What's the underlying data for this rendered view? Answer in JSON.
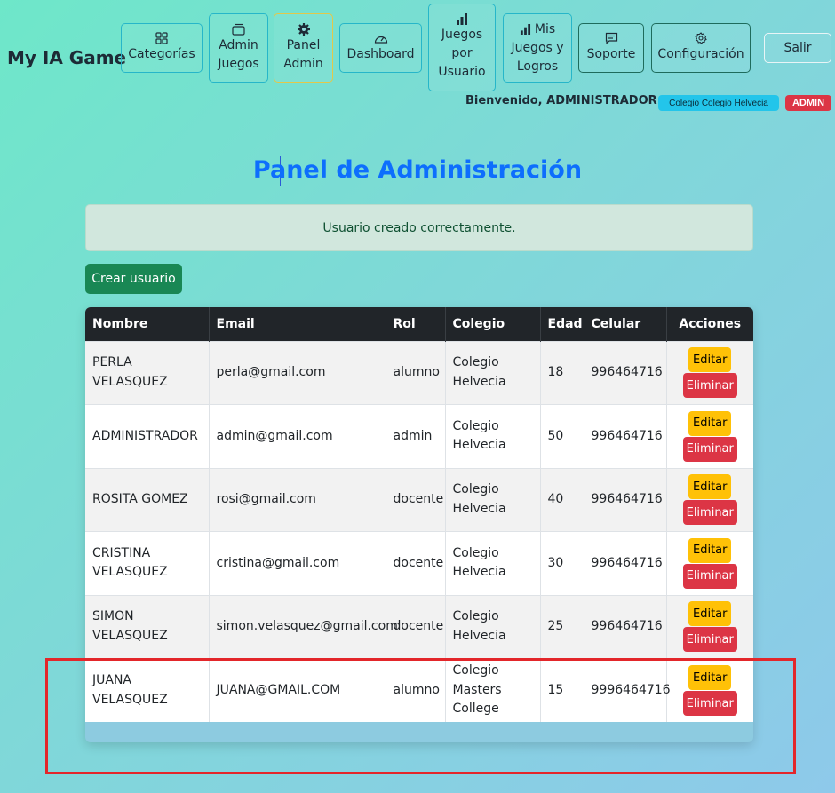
{
  "brand": "My IA Game",
  "nav": {
    "categorias": "Categorías",
    "admin_juegos_1": "Admin",
    "admin_juegos_2": "Juegos",
    "panel_admin_1": "Panel",
    "panel_admin_2": "Admin",
    "dashboard": "Dashboard",
    "juegos_usuario_1": "Juegos",
    "juegos_usuario_2": "por",
    "juegos_usuario_3": "Usuario",
    "mis_juegos_1": "Mis",
    "mis_juegos_2": "Juegos y",
    "mis_juegos_3": "Logros",
    "soporte": "Soporte",
    "configuracion": "Configuración",
    "salir": "Salir"
  },
  "user": {
    "welcome": "Bienvenido, ADMINISTRADOR",
    "school_badge": "Colegio Colegio Helvecia",
    "role_badge": "ADMIN"
  },
  "page": {
    "title": "Panel de Administración",
    "alert": "Usuario creado correctamente.",
    "create_button": "Crear usuario"
  },
  "table": {
    "headers": {
      "nombre": "Nombre",
      "email": "Email",
      "rol": "Rol",
      "colegio": "Colegio",
      "edad": "Edad",
      "celular": "Celular",
      "acciones": "Acciones"
    },
    "edit_label": "Editar",
    "delete_label": "Eliminar",
    "rows": [
      {
        "nombre_1": "PERLA VELASQUEZ",
        "nombre_2": "",
        "email": "perla@gmail.com",
        "rol": "alumno",
        "colegio_1": "Colegio",
        "colegio_2": "Helvecia",
        "colegio_3": "",
        "edad": "18",
        "celular": "996464716"
      },
      {
        "nombre_1": "ADMINISTRADOR",
        "nombre_2": "",
        "email": "admin@gmail.com",
        "rol": "admin",
        "colegio_1": "Colegio",
        "colegio_2": "Helvecia",
        "colegio_3": "",
        "edad": "50",
        "celular": "996464716"
      },
      {
        "nombre_1": "ROSITA GOMEZ",
        "nombre_2": "",
        "email": "rosi@gmail.com",
        "rol": "docente",
        "colegio_1": "Colegio",
        "colegio_2": "Helvecia",
        "colegio_3": "",
        "edad": "40",
        "celular": "996464716"
      },
      {
        "nombre_1": "CRISTINA",
        "nombre_2": "VELASQUEZ",
        "email": "cristina@gmail.com",
        "rol": "docente",
        "colegio_1": "Colegio",
        "colegio_2": "Helvecia",
        "colegio_3": "",
        "edad": "30",
        "celular": "996464716"
      },
      {
        "nombre_1": "SIMON",
        "nombre_2": "VELASQUEZ",
        "email": "simon.velasquez@gmail.com",
        "rol": "docente",
        "colegio_1": "Colegio",
        "colegio_2": "Helvecia",
        "colegio_3": "",
        "edad": "25",
        "celular": "996464716"
      },
      {
        "nombre_1": "JUANA",
        "nombre_2": "VELASQUEZ",
        "email": "JUANA@GMAIL.COM",
        "rol": "alumno",
        "colegio_1": "Colegio",
        "colegio_2": "Masters",
        "colegio_3": "College",
        "edad": "15",
        "celular": "9996464716"
      }
    ]
  },
  "colors": {
    "accent": "#0d6efd",
    "success": "#198754",
    "warning": "#ffc107",
    "danger": "#dc3545",
    "info": "#23c5ea",
    "annotation": "#e3262a"
  }
}
